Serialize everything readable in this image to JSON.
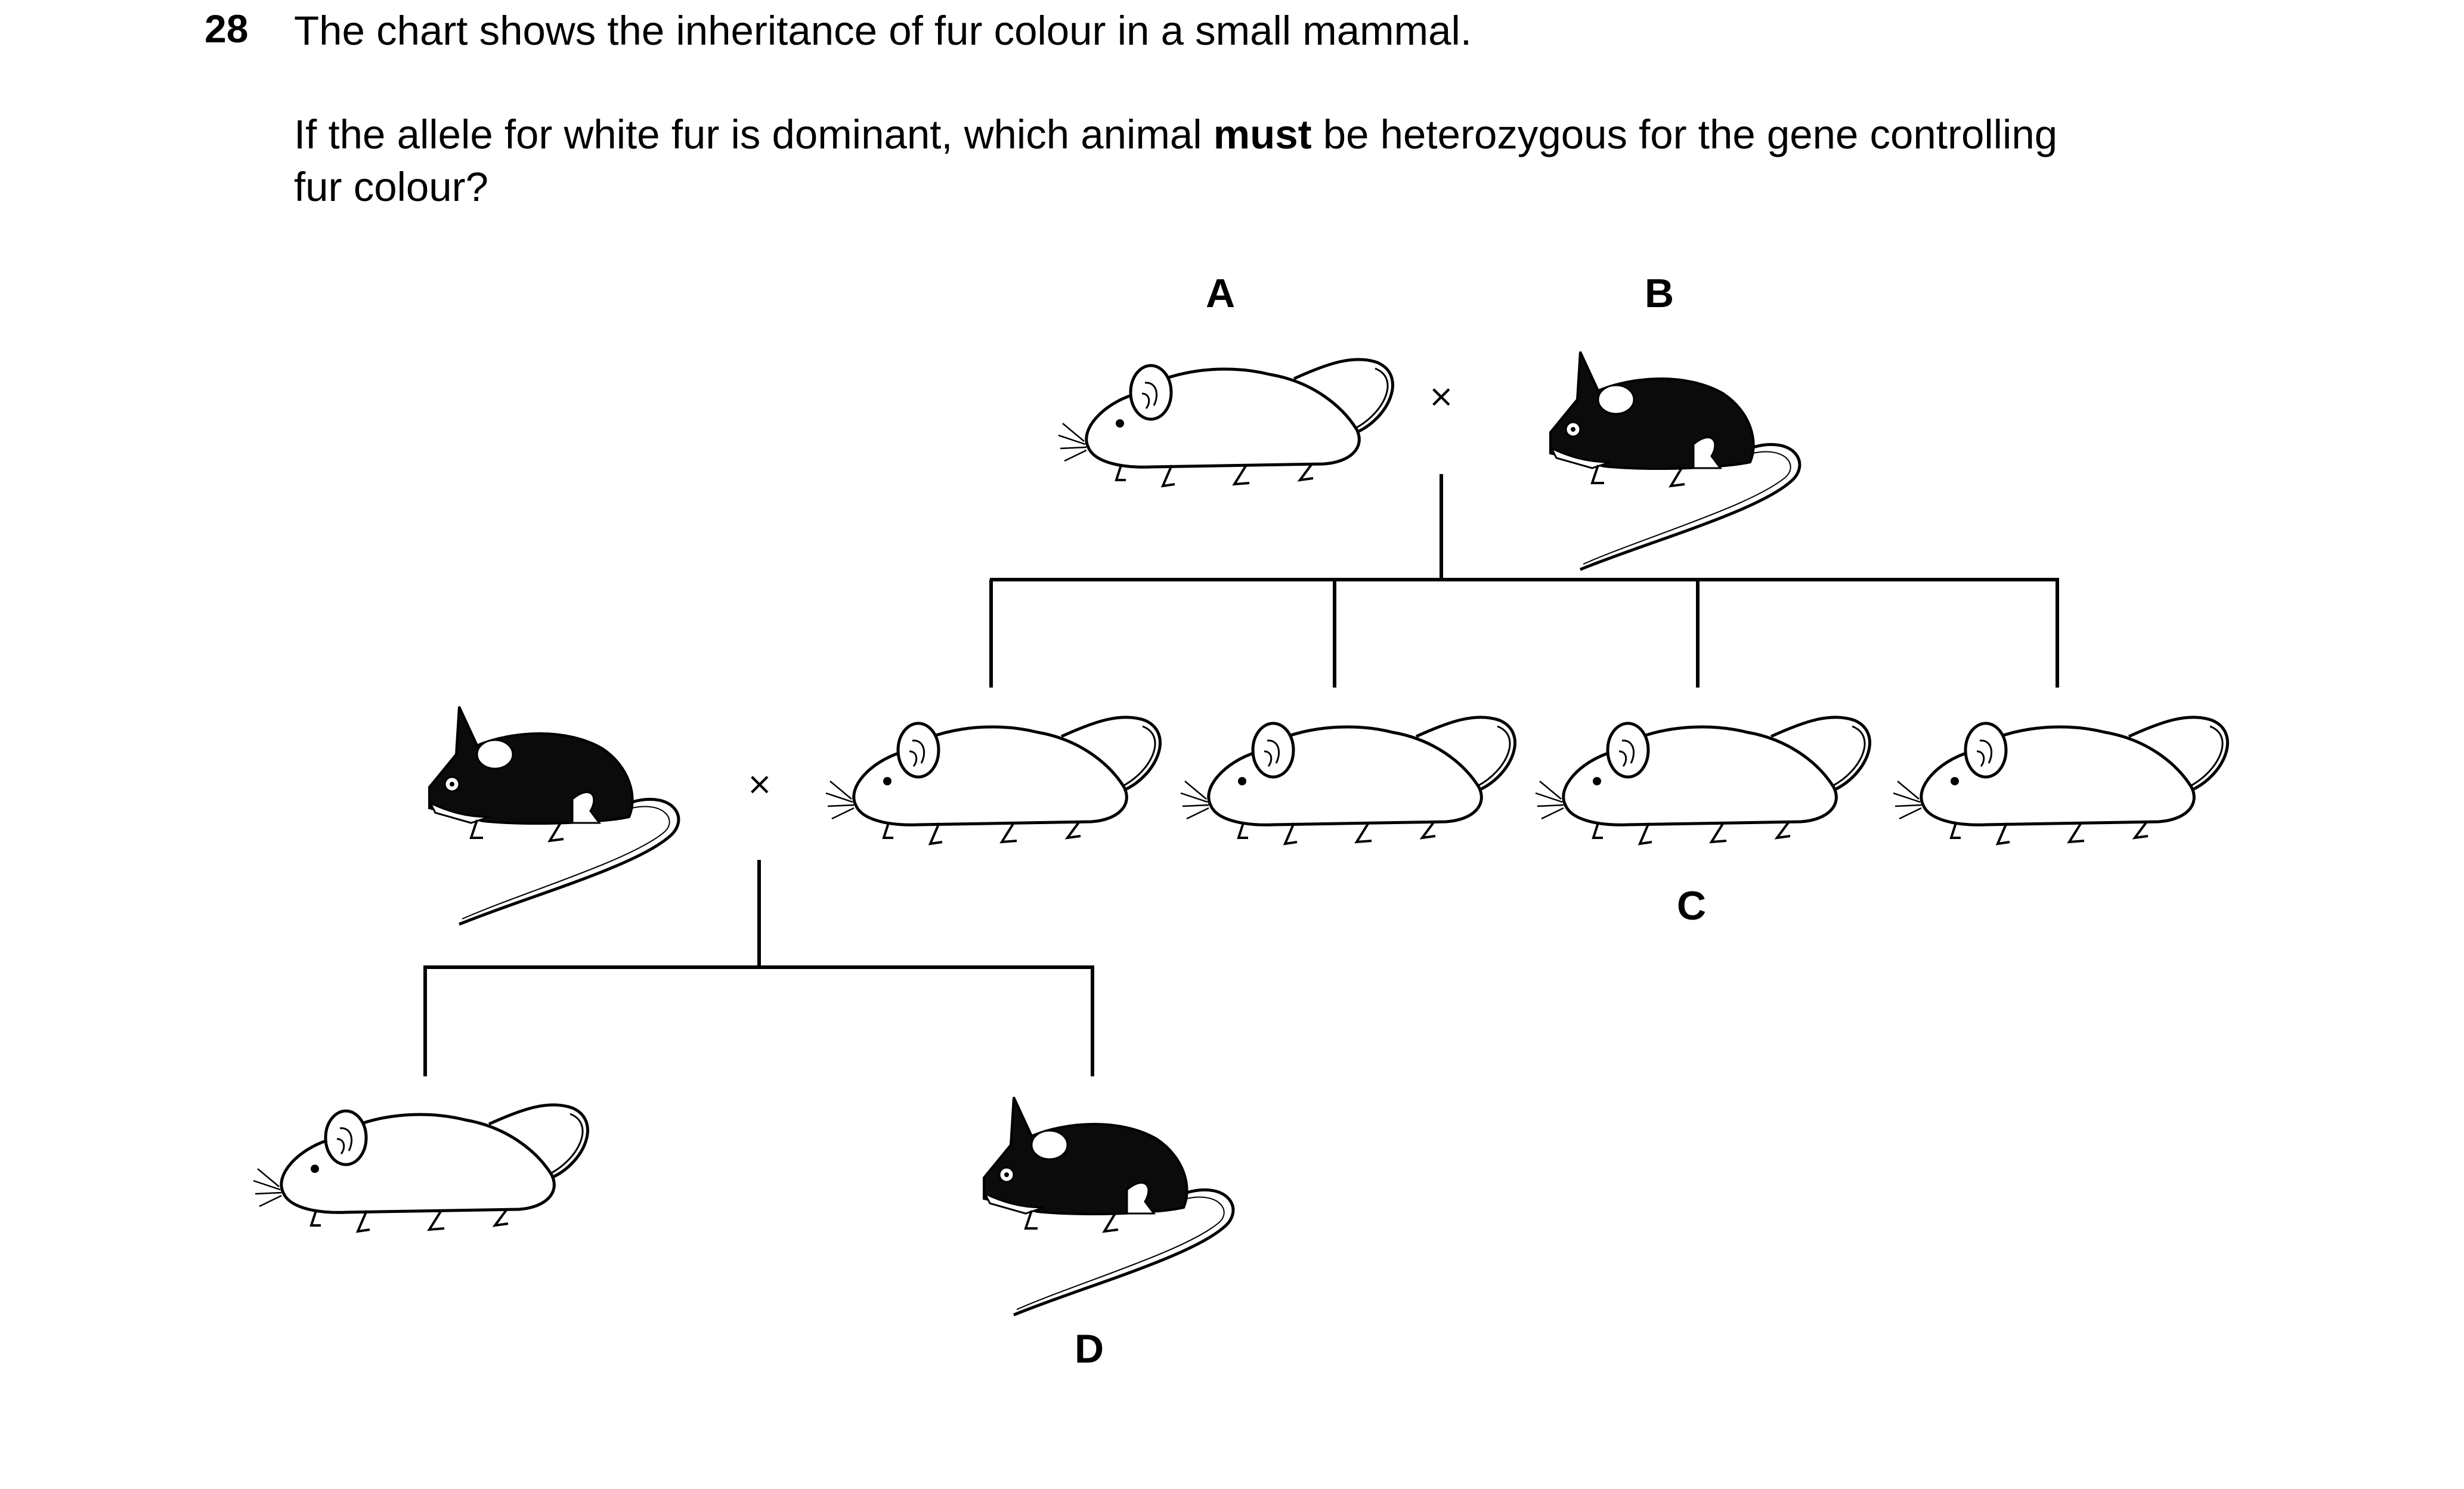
{
  "question": {
    "number": "28",
    "line1": "The chart shows the inheritance of fur colour in a small mammal.",
    "line2_before": "If the allele for white fur is dominant, which animal ",
    "line2_bold": "must",
    "line2_after": " be heterozygous for the gene controlling",
    "line3": "fur colour?"
  },
  "labels": {
    "a": "A",
    "b": "B",
    "c": "C",
    "d": "D"
  },
  "cross_symbol": "×",
  "colors": {
    "black_fur": "#0b0b0b",
    "white_fur": "#ffffff",
    "line": "#000000"
  },
  "animals": [
    {
      "id": "A",
      "fur": "white",
      "generation": "parent"
    },
    {
      "id": "B",
      "fur": "black",
      "generation": "parent"
    },
    {
      "id": "offspring-1",
      "fur": "white",
      "generation": "F1"
    },
    {
      "id": "offspring-2",
      "fur": "white",
      "generation": "F1"
    },
    {
      "id": "C",
      "fur": "white",
      "generation": "F1"
    },
    {
      "id": "offspring-4",
      "fur": "white",
      "generation": "F1"
    },
    {
      "id": "mate",
      "fur": "black",
      "generation": "F1-mate"
    },
    {
      "id": "offspring-5",
      "fur": "white",
      "generation": "F2"
    },
    {
      "id": "D",
      "fur": "black",
      "generation": "F2"
    }
  ]
}
